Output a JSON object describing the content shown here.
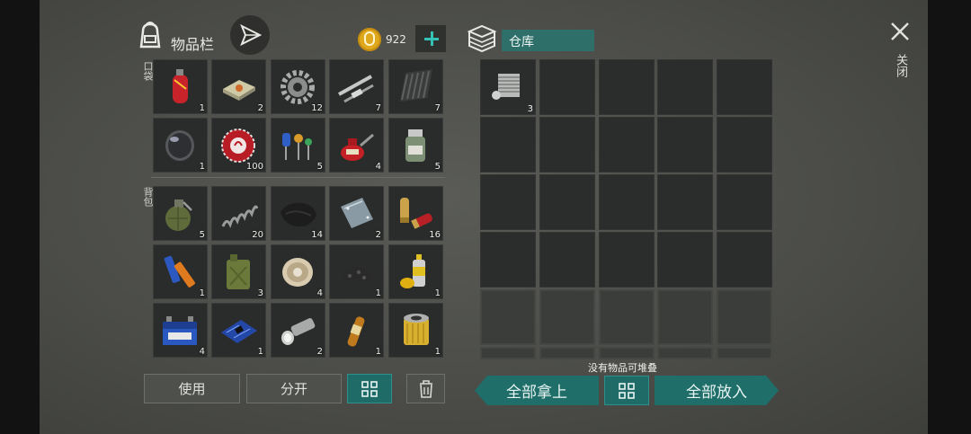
{
  "header": {
    "inventory_title": "物品栏",
    "coins": "922",
    "warehouse_title": "仓库",
    "close_label": "关闭"
  },
  "sections": {
    "pocket": "口袋",
    "backpack": "背包"
  },
  "pocket_items": [
    {
      "name": "gas-cylinder",
      "count": "1"
    },
    {
      "name": "soap-bar",
      "count": "2"
    },
    {
      "name": "gear",
      "count": "12"
    },
    {
      "name": "metal-rods",
      "count": "7"
    },
    {
      "name": "metal-sheet",
      "count": "7"
    },
    {
      "name": "lens",
      "count": "1"
    },
    {
      "name": "bottle-cap",
      "count": "100"
    },
    {
      "name": "electronic-components",
      "count": "5"
    },
    {
      "name": "oil-can",
      "count": "4"
    },
    {
      "name": "chemical-jar",
      "count": "5"
    }
  ],
  "backpack_items": [
    {
      "name": "grenade",
      "count": "5"
    },
    {
      "name": "spring",
      "count": "20"
    },
    {
      "name": "leather",
      "count": "14"
    },
    {
      "name": "metal-plate",
      "count": "2"
    },
    {
      "name": "ammo-shells",
      "count": "16"
    },
    {
      "name": "batteries",
      "count": "1"
    },
    {
      "name": "jerrycan",
      "count": "3"
    },
    {
      "name": "wire-spool",
      "count": "4"
    },
    {
      "name": "gunpowder",
      "count": "1"
    },
    {
      "name": "spray-can",
      "count": "1"
    },
    {
      "name": "car-battery",
      "count": "4"
    },
    {
      "name": "circuit-board",
      "count": "1"
    },
    {
      "name": "flashlight",
      "count": "2"
    },
    {
      "name": "ampoule",
      "count": "1"
    },
    {
      "name": "oil-filter",
      "count": "1"
    }
  ],
  "warehouse_items": [
    {
      "name": "engine-cylinder",
      "count": "3"
    }
  ],
  "buttons": {
    "use": "使用",
    "split": "分开",
    "take_all": "全部拿上",
    "put_all": "全部放入"
  },
  "warehouse_status": "没有物品可堆叠",
  "colors": {
    "accent": "#1f6e6a",
    "coin": "#e0a81c",
    "plus": "#35c2b6"
  }
}
